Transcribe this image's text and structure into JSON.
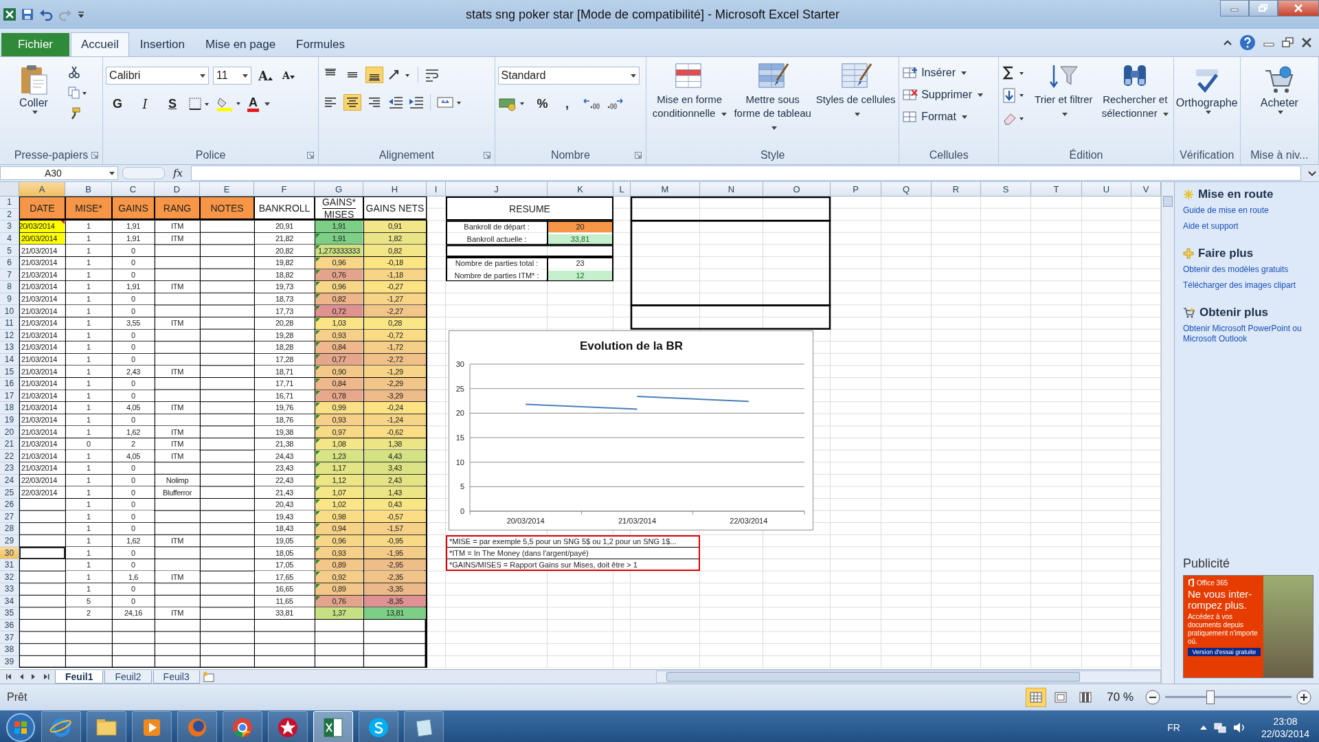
{
  "window": {
    "title": "stats sng poker star  [Mode de compatibilité]  -  Microsoft Excel Starter"
  },
  "ribbon": {
    "tabs": [
      {
        "label": "Fichier",
        "kind": "file",
        "selected": false
      },
      {
        "label": "Accueil",
        "kind": "tab",
        "selected": true
      },
      {
        "label": "Insertion",
        "kind": "tab",
        "selected": false
      },
      {
        "label": "Mise en page",
        "kind": "tab",
        "selected": false
      },
      {
        "label": "Formules",
        "kind": "tab",
        "selected": false
      }
    ],
    "groups": [
      {
        "kind": "clipboard",
        "label": "Presse-papiers",
        "button": "Coller"
      },
      {
        "kind": "font",
        "label": "Police",
        "font": "Calibri",
        "size": "11",
        "grow": "A",
        "shrink": "A",
        "styles": [
          "G",
          "I",
          "S"
        ],
        "color_glyph": "A"
      },
      {
        "kind": "alignment",
        "label": "Alignement",
        "vertical": [
          {
            "selected": false
          },
          {
            "selected": false
          },
          {
            "selected": true
          }
        ],
        "horizontal": [
          {
            "selected": false
          },
          {
            "selected": true
          },
          {
            "selected": false
          }
        ]
      },
      {
        "kind": "number",
        "label": "Nombre",
        "format": "Standard",
        "symbols": [
          "%",
          ","
        ]
      },
      {
        "kind": "style",
        "label": "Style",
        "buttons": [
          "Mise en forme conditionnelle",
          "Mettre sous forme de tableau",
          "Styles de cellules"
        ]
      },
      {
        "kind": "cells",
        "label": "Cellules",
        "buttons": [
          "Insérer",
          "Supprimer",
          "Format"
        ]
      },
      {
        "kind": "editing",
        "label": "Édition",
        "buttons": [
          "Trier et filtrer",
          "Rechercher et sélectionner"
        ]
      },
      {
        "kind": "proofing",
        "label": "Vérification",
        "button": "Orthographe"
      },
      {
        "kind": "upgrade",
        "label": "Mise à niv...",
        "button": "Acheter"
      }
    ]
  },
  "formula_bar": {
    "name_box": "A30",
    "function_button": "fx"
  },
  "sheet": {
    "columns": [
      {
        "label": "A",
        "selected": true
      },
      {
        "label": "B",
        "selected": false
      },
      {
        "label": "C",
        "selected": false
      },
      {
        "label": "D",
        "selected": false
      },
      {
        "label": "E",
        "selected": false
      },
      {
        "label": "F",
        "selected": false
      },
      {
        "label": "G",
        "selected": false
      },
      {
        "label": "H",
        "selected": false
      },
      {
        "label": "I",
        "selected": false
      },
      {
        "label": "J",
        "selected": false
      },
      {
        "label": "K",
        "selected": false
      },
      {
        "label": "L",
        "selected": false
      },
      {
        "label": "M",
        "selected": false
      },
      {
        "label": "N",
        "selected": false
      },
      {
        "label": "O",
        "selected": false
      },
      {
        "label": "P",
        "selected": false
      },
      {
        "label": "Q",
        "selected": false
      },
      {
        "label": "R",
        "selected": false
      },
      {
        "label": "S",
        "selected": false
      },
      {
        "label": "T",
        "selected": false
      },
      {
        "label": "U",
        "selected": false
      },
      {
        "label": "V",
        "selected": false
      }
    ],
    "row_numbers": [
      {
        "label": "1",
        "selected": false
      },
      {
        "label": "2",
        "selected": false
      },
      {
        "label": "3",
        "selected": false
      },
      {
        "label": "4",
        "selected": false
      },
      {
        "label": "5",
        "selected": false
      },
      {
        "label": "6",
        "selected": false
      },
      {
        "label": "7",
        "selected": false
      },
      {
        "label": "8",
        "selected": false
      },
      {
        "label": "9",
        "selected": false
      },
      {
        "label": "10",
        "selected": false
      },
      {
        "label": "11",
        "selected": false
      },
      {
        "label": "12",
        "selected": false
      },
      {
        "label": "13",
        "selected": false
      },
      {
        "label": "14",
        "selected": false
      },
      {
        "label": "15",
        "selected": false
      },
      {
        "label": "16",
        "selected": false
      },
      {
        "label": "17",
        "selected": false
      },
      {
        "label": "18",
        "selected": false
      },
      {
        "label": "19",
        "selected": false
      },
      {
        "label": "20",
        "selected": false
      },
      {
        "label": "21",
        "selected": false
      },
      {
        "label": "22",
        "selected": false
      },
      {
        "label": "23",
        "selected": false
      },
      {
        "label": "24",
        "selected": false
      },
      {
        "label": "25",
        "selected": false
      },
      {
        "label": "26",
        "selected": false
      },
      {
        "label": "27",
        "selected": false
      },
      {
        "label": "28",
        "selected": false
      },
      {
        "label": "29",
        "selected": false
      },
      {
        "label": "30",
        "selected": true
      },
      {
        "label": "31",
        "selected": false
      },
      {
        "label": "32",
        "selected": false
      },
      {
        "label": "33",
        "selected": false
      },
      {
        "label": "34",
        "selected": false
      },
      {
        "label": "35",
        "selected": false
      },
      {
        "label": "36",
        "selected": false
      },
      {
        "label": "37",
        "selected": false
      },
      {
        "label": "38",
        "selected": false
      },
      {
        "label": "39",
        "selected": false
      }
    ],
    "tabs": [
      {
        "label": "Feuil1",
        "selected": true
      },
      {
        "label": "Feuil2",
        "selected": false
      },
      {
        "label": "Feuil3",
        "selected": false
      }
    ]
  },
  "table": {
    "headers": [
      {
        "lines": [
          "DATE"
        ],
        "filled": true
      },
      {
        "lines": [
          "MISE*"
        ],
        "filled": true
      },
      {
        "lines": [
          "GAINS"
        ],
        "filled": true
      },
      {
        "lines": [
          "RANG"
        ],
        "filled": true
      },
      {
        "lines": [
          "NOTES"
        ],
        "filled": true
      },
      {
        "lines": [
          "BANKROLL"
        ],
        "filled": false
      },
      {
        "lines": [
          "GAINS*",
          "MISES"
        ],
        "filled": false
      },
      {
        "lines": [
          "GAINS NETS"
        ],
        "filled": false
      }
    ],
    "rows": [
      {
        "date": {
          "text": "20/03/2014",
          "highlighted": true,
          "comment": true
        },
        "mise": "1",
        "gains": "1,91",
        "rang": "ITM",
        "bankroll": "20,91",
        "ratio": {
          "text": "1,91",
          "color": "#7dcf86",
          "flag": false
        },
        "net": {
          "text": "0,91",
          "color": "#f2e687"
        }
      },
      {
        "date": {
          "text": "20/03/2014",
          "highlighted": true,
          "comment": false
        },
        "mise": "1",
        "gains": "1,91",
        "rang": "ITM",
        "bankroll": "21,82",
        "ratio": {
          "text": "1,91",
          "color": "#7dcf86",
          "flag": true
        },
        "net": {
          "text": "1,82",
          "color": "#e9e586"
        }
      },
      {
        "date": {
          "text": "21/03/2014",
          "highlighted": false,
          "comment": false
        },
        "mise": "1",
        "gains": "0",
        "bankroll": "20,82",
        "ratio": {
          "text": "1,273333333",
          "color": "#cfe283",
          "flag": true
        },
        "net": {
          "text": "0,82",
          "color": "#f3e687"
        }
      },
      {
        "date": {
          "text": "21/03/2014",
          "highlighted": false,
          "comment": false
        },
        "mise": "1",
        "gains": "0",
        "bankroll": "19,82",
        "ratio": {
          "text": "0,96",
          "color": "#f7d687",
          "flag": true
        },
        "net": {
          "text": "-0,18",
          "color": "#fde584"
        }
      },
      {
        "date": {
          "text": "21/03/2014",
          "highlighted": false,
          "comment": false
        },
        "mise": "1",
        "gains": "0",
        "bankroll": "18,82",
        "ratio": {
          "text": "0,76",
          "color": "#e4a48c",
          "flag": true
        },
        "net": {
          "text": "-1,18",
          "color": "#f8d586"
        }
      },
      {
        "date": {
          "text": "21/03/2014",
          "highlighted": false,
          "comment": false
        },
        "mise": "1",
        "gains": "1,91",
        "rang": "ITM",
        "bankroll": "19,73",
        "ratio": {
          "text": "0,96",
          "color": "#f7d687",
          "flag": true
        },
        "net": {
          "text": "-0,27",
          "color": "#fde384"
        }
      },
      {
        "date": {
          "text": "21/03/2014",
          "highlighted": false,
          "comment": false
        },
        "mise": "1",
        "gains": "0",
        "bankroll": "18,73",
        "ratio": {
          "text": "0,82",
          "color": "#ecb58a",
          "flag": true
        },
        "net": {
          "text": "-1,27",
          "color": "#f7d486"
        }
      },
      {
        "date": {
          "text": "21/03/2014",
          "highlighted": false,
          "comment": false
        },
        "mise": "1",
        "gains": "0",
        "bankroll": "17,73",
        "ratio": {
          "text": "0,72",
          "color": "#e09290",
          "flag": true
        },
        "net": {
          "text": "-2,27",
          "color": "#f2c688"
        }
      },
      {
        "date": {
          "text": "21/03/2014",
          "highlighted": false,
          "comment": false
        },
        "mise": "1",
        "gains": "3,55",
        "rang": "ITM",
        "bankroll": "20,28",
        "ratio": {
          "text": "1,03",
          "color": "#fbe486",
          "flag": true
        },
        "net": {
          "text": "0,28",
          "color": "#fbe685"
        }
      },
      {
        "date": {
          "text": "21/03/2014",
          "highlighted": false,
          "comment": false
        },
        "mise": "1",
        "gains": "0",
        "bankroll": "19,28",
        "ratio": {
          "text": "0,93",
          "color": "#f6d088",
          "flag": true
        },
        "net": {
          "text": "-0,72",
          "color": "#fbdc85"
        }
      },
      {
        "date": {
          "text": "21/03/2014",
          "highlighted": false,
          "comment": false
        },
        "mise": "1",
        "gains": "0",
        "bankroll": "18,28",
        "ratio": {
          "text": "0,84",
          "color": "#eeb88a",
          "flag": true
        },
        "net": {
          "text": "-1,72",
          "color": "#f5ce87"
        }
      },
      {
        "date": {
          "text": "21/03/2014",
          "highlighted": false,
          "comment": false
        },
        "mise": "1",
        "gains": "0",
        "bankroll": "17,28",
        "ratio": {
          "text": "0,77",
          "color": "#e6a68c",
          "flag": true
        },
        "net": {
          "text": "-2,72",
          "color": "#f0c088"
        }
      },
      {
        "date": {
          "text": "21/03/2014",
          "highlighted": false,
          "comment": false
        },
        "mise": "1",
        "gains": "2,43",
        "rang": "ITM",
        "bankroll": "18,71",
        "ratio": {
          "text": "0,90",
          "color": "#f4c988",
          "flag": true
        },
        "net": {
          "text": "-1,29",
          "color": "#f7d486"
        }
      },
      {
        "date": {
          "text": "21/03/2014",
          "highlighted": false,
          "comment": false
        },
        "mise": "1",
        "gains": "0",
        "bankroll": "17,71",
        "ratio": {
          "text": "0,84",
          "color": "#eeb88a",
          "flag": true
        },
        "net": {
          "text": "-2,29",
          "color": "#f2c588"
        }
      },
      {
        "date": {
          "text": "21/03/2014",
          "highlighted": false,
          "comment": false
        },
        "mise": "1",
        "gains": "0",
        "bankroll": "16,71",
        "ratio": {
          "text": "0,78",
          "color": "#e8a88b",
          "flag": true
        },
        "net": {
          "text": "-3,29",
          "color": "#edbc89"
        }
      },
      {
        "date": {
          "text": "21/03/2014",
          "highlighted": false,
          "comment": false
        },
        "mise": "1",
        "gains": "4,05",
        "rang": "ITM",
        "bankroll": "19,76",
        "ratio": {
          "text": "0,99",
          "color": "#fae086",
          "flag": true
        },
        "net": {
          "text": "-0,24",
          "color": "#fce384"
        }
      },
      {
        "date": {
          "text": "21/03/2014",
          "highlighted": false,
          "comment": false
        },
        "mise": "1",
        "gains": "0",
        "bankroll": "18,76",
        "ratio": {
          "text": "0,93",
          "color": "#f6d088",
          "flag": true
        },
        "net": {
          "text": "-1,24",
          "color": "#f7d586"
        }
      },
      {
        "date": {
          "text": "21/03/2014",
          "highlighted": false,
          "comment": false
        },
        "mise": "1",
        "gains": "1,62",
        "rang": "ITM",
        "bankroll": "19,38",
        "ratio": {
          "text": "0,97",
          "color": "#f8da86",
          "flag": true
        },
        "net": {
          "text": "-0,62",
          "color": "#fadd85"
        }
      },
      {
        "date": {
          "text": "21/03/2014",
          "highlighted": false,
          "comment": false
        },
        "mise": "0",
        "gains": "2",
        "rang": "ITM",
        "bankroll": "21,38",
        "ratio": {
          "text": "1,08",
          "color": "#f4e686",
          "flag": true
        },
        "net": {
          "text": "1,38",
          "color": "#ece585"
        }
      },
      {
        "date": {
          "text": "21/03/2014",
          "highlighted": false,
          "comment": false
        },
        "mise": "1",
        "gains": "4,05",
        "rang": "ITM",
        "bankroll": "24,43",
        "ratio": {
          "text": "1,23",
          "color": "#d8e384",
          "flag": true
        },
        "net": {
          "text": "4,43",
          "color": "#d4e283"
        }
      },
      {
        "date": {
          "text": "21/03/2014",
          "highlighted": false,
          "comment": false
        },
        "mise": "1",
        "gains": "0",
        "bankroll": "23,43",
        "ratio": {
          "text": "1,17",
          "color": "#e2e485",
          "flag": true
        },
        "net": {
          "text": "3,43",
          "color": "#dde384"
        }
      },
      {
        "date": {
          "text": "22/03/2014",
          "highlighted": false,
          "comment": false
        },
        "mise": "1",
        "gains": "0",
        "rang": "Nolimp",
        "bankroll": "22,43",
        "ratio": {
          "text": "1,12",
          "color": "#ece685",
          "flag": true
        },
        "net": {
          "text": "2,43",
          "color": "#e4e485"
        }
      },
      {
        "date": {
          "text": "22/03/2014",
          "highlighted": false,
          "comment": false
        },
        "mise": "1",
        "gains": "0",
        "rang": "Blufferror",
        "bankroll": "21,43",
        "ratio": {
          "text": "1,07",
          "color": "#f6e786",
          "flag": true
        },
        "net": {
          "text": "1,43",
          "color": "#ebe585"
        }
      },
      {
        "mise": "1",
        "gains": "0",
        "bankroll": "20,43",
        "ratio": {
          "text": "1,02",
          "color": "#fae686",
          "flag": true
        },
        "net": {
          "text": "0,43",
          "color": "#f8e684"
        }
      },
      {
        "mise": "1",
        "gains": "0",
        "bankroll": "19,43",
        "ratio": {
          "text": "0,98",
          "color": "#f9dd86",
          "flag": true
        },
        "net": {
          "text": "-0,57",
          "color": "#fadd85"
        }
      },
      {
        "mise": "1",
        "gains": "0",
        "bankroll": "18,43",
        "ratio": {
          "text": "0,94",
          "color": "#f6d287",
          "flag": true
        },
        "net": {
          "text": "-1,57",
          "color": "#f6d087"
        }
      },
      {
        "mise": "1",
        "gains": "1,62",
        "rang": "ITM",
        "bankroll": "19,05",
        "ratio": {
          "text": "0,96",
          "color": "#f7d687",
          "flag": true
        },
        "net": {
          "text": "-0,95",
          "color": "#f9d985"
        }
      },
      {
        "mise": "1",
        "gains": "0",
        "bankroll": "18,05",
        "ratio": {
          "text": "0,93",
          "color": "#f6d088",
          "flag": true
        },
        "net": {
          "text": "-1,95",
          "color": "#f4cb87"
        }
      },
      {
        "mise": "1",
        "gains": "0",
        "bankroll": "17,05",
        "ratio": {
          "text": "0,89",
          "color": "#f3c788",
          "flag": true
        },
        "net": {
          "text": "-2,95",
          "color": "#efbe88"
        }
      },
      {
        "mise": "1",
        "gains": "1,6",
        "rang": "ITM",
        "bankroll": "17,65",
        "ratio": {
          "text": "0,92",
          "color": "#f5cd88",
          "flag": true
        },
        "net": {
          "text": "-2,35",
          "color": "#f1c388"
        }
      },
      {
        "mise": "1",
        "gains": "0",
        "bankroll": "16,65",
        "ratio": {
          "text": "0,89",
          "color": "#f3c788",
          "flag": true
        },
        "net": {
          "text": "-3,35",
          "color": "#ecba89"
        }
      },
      {
        "mise": "5",
        "gains": "0",
        "bankroll": "11,65",
        "ratio": {
          "text": "0,76",
          "color": "#e4a48c",
          "flag": true
        },
        "net": {
          "text": "-8,35",
          "color": "#e09191"
        }
      },
      {
        "mise": "2",
        "gains": "24,16",
        "rang": "ITM",
        "bankroll": "33,81",
        "ratio": {
          "text": "1,37",
          "color": "#c6e183",
          "flag": false
        },
        "net": {
          "text": "13,81",
          "color": "#7dcf86"
        }
      }
    ]
  },
  "summary": {
    "title": "RESUME",
    "groups": [
      [
        {
          "label": "Bankroll de départ :",
          "value": "20",
          "kind": "orange"
        },
        {
          "label": "Bankroll actuelle :",
          "value": "33,81",
          "kind": "green"
        }
      ],
      [
        {
          "label": "Nombre de parties total :",
          "value": "23",
          "kind": "plain"
        },
        {
          "label": "Nombre de parties ITM* :",
          "value": "12",
          "kind": "green"
        }
      ]
    ]
  },
  "chart": {
    "chart_data": {
      "type": "line",
      "title": "Evolution de la BR",
      "categories": [
        "20/03/2014",
        "21/03/2014",
        "22/03/2014"
      ],
      "series": [
        {
          "color": "#4a7ebb",
          "values": [
            21.8,
            20.8,
            null
          ]
        },
        {
          "color": "#4a7ebb",
          "values": [
            null,
            23.4,
            22.4
          ]
        }
      ],
      "ylim": [
        0,
        30
      ],
      "yticks": [
        0,
        5,
        10,
        15,
        20,
        25,
        30
      ],
      "grid": true
    }
  },
  "notes": [
    "*MISE = par exemple 5,5 pour un SNG 5$ ou 1,2 pour un SNG 1$...",
    "*ITM = In The Money (dans l'argent/payé)",
    "*GAINS/MISES = Rapport Gains sur Mises, doit être > 1"
  ],
  "task_pane": {
    "sections": [
      {
        "kind": "start",
        "title": "Mise en route",
        "links": [
          "Guide de mise en route",
          "Aide et support"
        ]
      },
      {
        "kind": "more",
        "title": "Faire plus",
        "links": [
          "Obtenir des modèles gratuits",
          "Télécharger des images clipart"
        ]
      },
      {
        "kind": "shop",
        "title": "Obtenir plus",
        "links": [
          "Obtenir Microsoft PowerPoint ou Microsoft Outlook"
        ]
      }
    ],
    "ad_heading": "Publicité",
    "ad": {
      "brand": "Office 365",
      "headline": "Ne vous inter-rompez plus.",
      "body": "Accédez à vos documents depuis pratiquement n'importe où.",
      "button": "Version d'essai gratuite"
    }
  },
  "status_bar": {
    "status": "Prêt",
    "views": [
      {
        "kind": "normal",
        "selected": true
      },
      {
        "kind": "layout",
        "selected": false
      },
      {
        "kind": "pagebreak",
        "selected": false
      }
    ],
    "zoom": "70 %",
    "zoom_slider": {
      "level": 0.36
    }
  },
  "taskbar": {
    "apps": [
      {
        "kind": "ie",
        "selected": false
      },
      {
        "kind": "folder",
        "selected": false
      },
      {
        "kind": "media",
        "selected": false
      },
      {
        "kind": "firefox",
        "selected": false
      },
      {
        "kind": "chrome",
        "selected": false
      },
      {
        "kind": "poker",
        "selected": false
      },
      {
        "kind": "excel",
        "selected": true
      },
      {
        "kind": "skype",
        "selected": false
      },
      {
        "kind": "notes",
        "selected": false
      }
    ],
    "language": "FR",
    "time": "23:08",
    "date": "22/03/2014"
  }
}
